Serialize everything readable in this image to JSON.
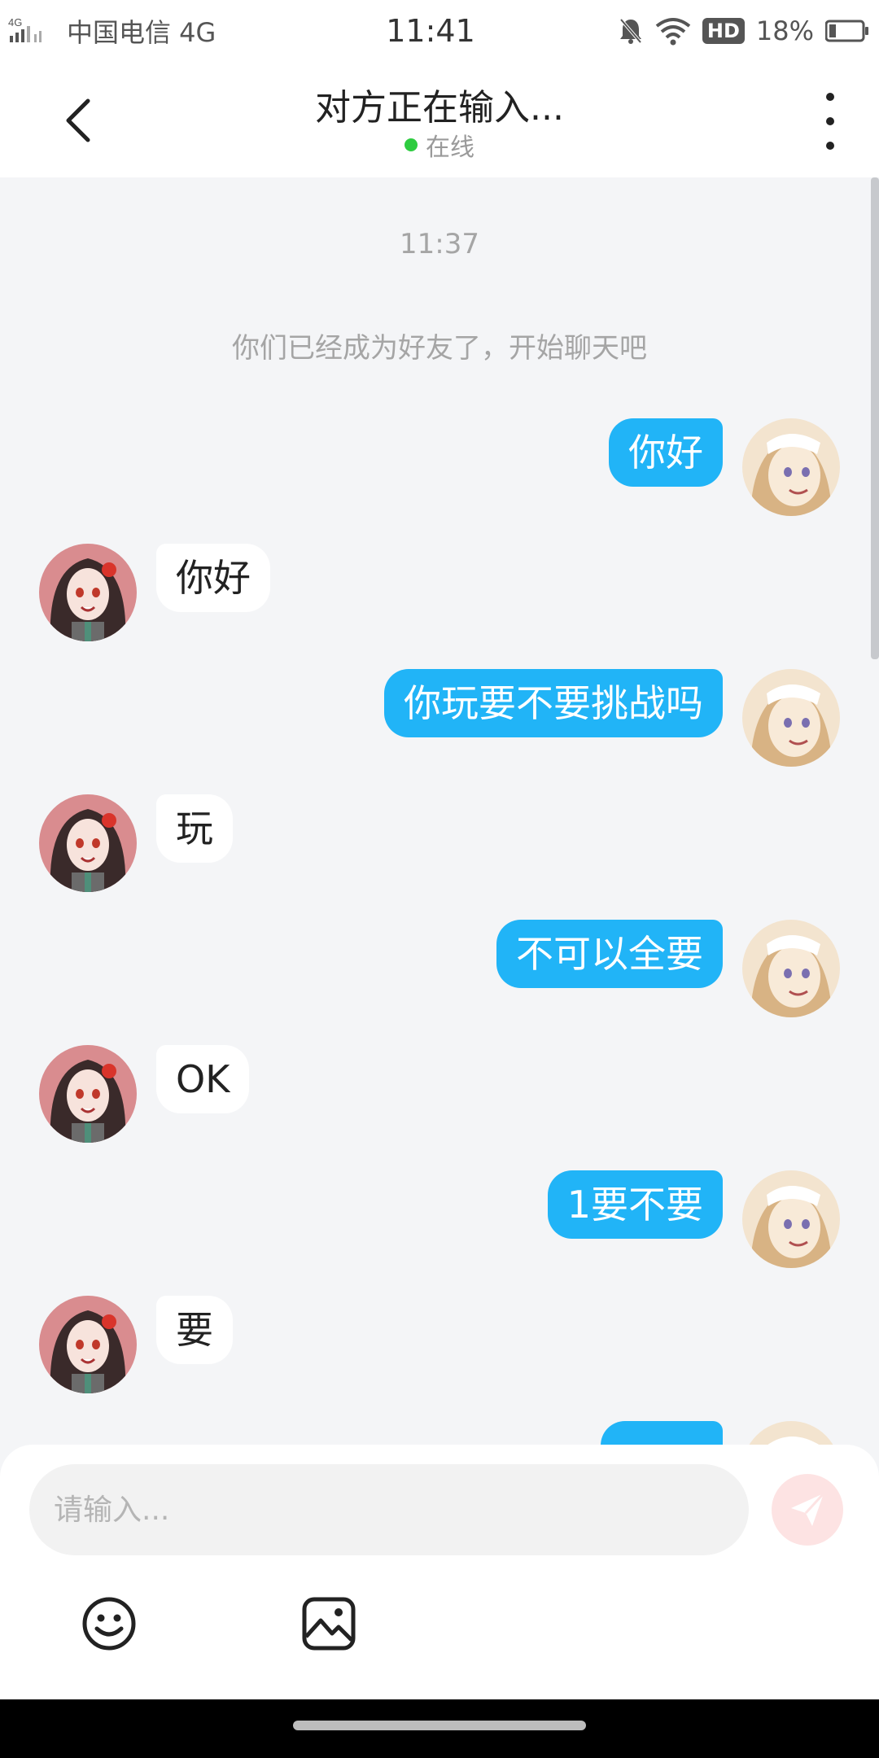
{
  "status_bar": {
    "carrier": "中国电信 4G",
    "time": "11:41",
    "hd_badge": "HD",
    "battery": "18%"
  },
  "header": {
    "title": "对方正在输入...",
    "status": "在线"
  },
  "chat": {
    "timestamp": "11:37",
    "system_note": "你们已经成为好友了，开始聊天吧",
    "messages": [
      {
        "from": "me",
        "text": "你好"
      },
      {
        "from": "other",
        "text": "你好"
      },
      {
        "from": "me",
        "text": "你玩要不要挑战吗"
      },
      {
        "from": "other",
        "text": "玩"
      },
      {
        "from": "me",
        "text": "不可以全要"
      },
      {
        "from": "other",
        "text": "OK"
      },
      {
        "from": "me",
        "text": "1要不要"
      },
      {
        "from": "other",
        "text": "要"
      },
      {
        "from": "me",
        "text": ""
      }
    ]
  },
  "input": {
    "placeholder": "请输入..."
  },
  "icons": {
    "back": "back-arrow-icon",
    "more": "more-vertical-icon",
    "send": "send-paper-plane-icon",
    "emoji": "emoji-smile-icon",
    "image": "image-picture-icon"
  },
  "colors": {
    "my_bubble": "#21b4f7",
    "other_bubble": "#ffffff",
    "online_dot": "#2ecc40",
    "send_button": "#fde3e3",
    "background": "#f4f5f7"
  }
}
